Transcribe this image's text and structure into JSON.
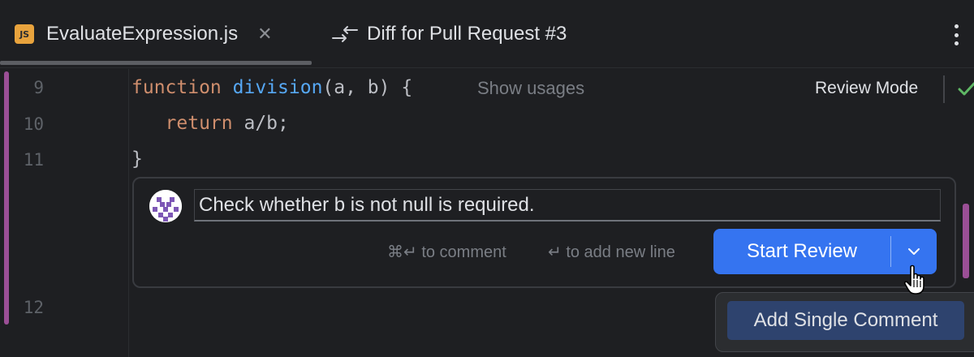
{
  "tabs": [
    {
      "label": "EvaluateExpression.js",
      "icon": "js-file-icon",
      "icon_text": "JS",
      "closable": true,
      "active": true
    },
    {
      "label": "Diff for Pull Request #3",
      "icon": "diff-icon"
    }
  ],
  "editor": {
    "lines": [
      {
        "number": "9",
        "keyword": "function",
        "function_name": "division",
        "rest": "(a, b) {"
      },
      {
        "number": "10",
        "keyword": "return",
        "rest": " a/b;"
      },
      {
        "number": "11",
        "rest": "}"
      },
      {
        "number": "12",
        "rest": ""
      }
    ],
    "inlay_hint": "Show usages",
    "review_mode_label": "Review Mode"
  },
  "comment": {
    "input_value": "Check whether b is not null is required.",
    "hint_comment": "⌘↵ to comment",
    "hint_newline": "↵ to add new line",
    "primary_button": "Start Review",
    "dropdown_item": "Add Single Comment"
  },
  "colors": {
    "background": "#1e1f22",
    "accent_blue": "#3574f0",
    "change_marker": "#9b4f96",
    "keyword": "#cf8e6d",
    "function": "#56a8f5",
    "js_icon": "#e8a33d",
    "success_green": "#5fb865"
  }
}
